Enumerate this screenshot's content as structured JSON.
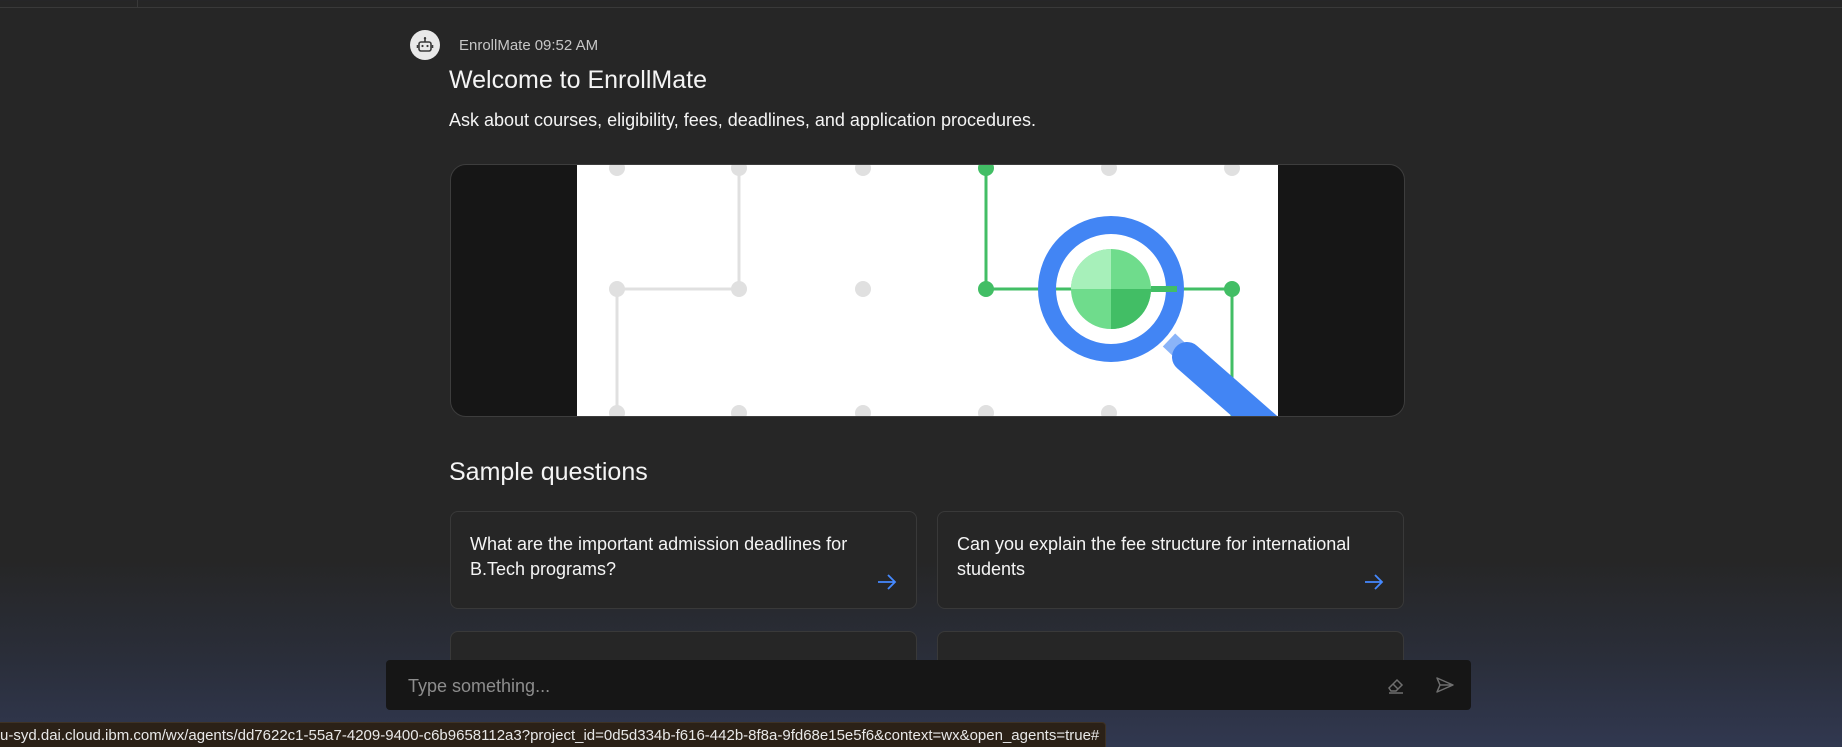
{
  "message": {
    "sender": "EnrollMate",
    "time": "09:52 AM",
    "avatar_icon": "robot-icon",
    "title": "Welcome to EnrollMate",
    "subtitle": "Ask about courses, eligibility, fees, deadlines, and application procedures.",
    "image_icon": "search-magnifier-illustration"
  },
  "sample_questions": {
    "title": "Sample questions",
    "items": [
      {
        "text": "What are the important admission deadlines for B.Tech programs?"
      },
      {
        "text": "Can you explain the fee structure for international students"
      },
      {
        "text": ""
      },
      {
        "text": ""
      }
    ],
    "arrow_icon": "arrow-right-icon"
  },
  "composer": {
    "placeholder": "Type something...",
    "clear_icon": "eraser-icon",
    "send_icon": "send-icon"
  },
  "status_url": "u-syd.dai.cloud.ibm.com/wx/agents/dd7622c1-55a7-4209-9400-c6b9658112a3?project_id=0d5d334b-f616-442b-8f8a-9fd68e15e5f6&context=wx&open_agents=true#",
  "colors": {
    "background": "#262626",
    "accent_blue": "#4589ff",
    "accent_green": "#42be65",
    "magnifier_blue": "#4285f4"
  }
}
